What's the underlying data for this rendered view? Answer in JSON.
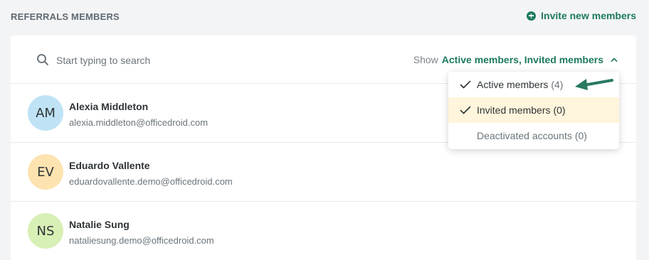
{
  "header": {
    "title": "REFERRALS MEMBERS",
    "invite_label": "Invite new members"
  },
  "search": {
    "placeholder": "Start typing to search"
  },
  "filter": {
    "show_label": "Show",
    "show_value": "Active members, Invited members"
  },
  "members": [
    {
      "initials": "AM",
      "name": "Alexia Middleton",
      "email": "alexia.middleton@officedroid.com",
      "avatar_color": "#bfe3f5"
    },
    {
      "initials": "EV",
      "name": "Eduardo Vallente",
      "email": "eduardovallente.demo@officedroid.com",
      "avatar_color": "#fde3b0"
    },
    {
      "initials": "NS",
      "name": "Natalie Sung",
      "email": "nataliesung.demo@officedroid.com",
      "avatar_color": "#d8efb6"
    }
  ],
  "dropdown": {
    "items": [
      {
        "label": "Active members",
        "count": "(4)",
        "checked": true
      },
      {
        "label": "Invited members",
        "count": "(0)",
        "checked": true
      },
      {
        "label": "Deactivated accounts",
        "count": "(0)",
        "checked": false
      }
    ]
  },
  "colors": {
    "accent": "#1d7a5f",
    "highlight": "#fff5dc"
  }
}
